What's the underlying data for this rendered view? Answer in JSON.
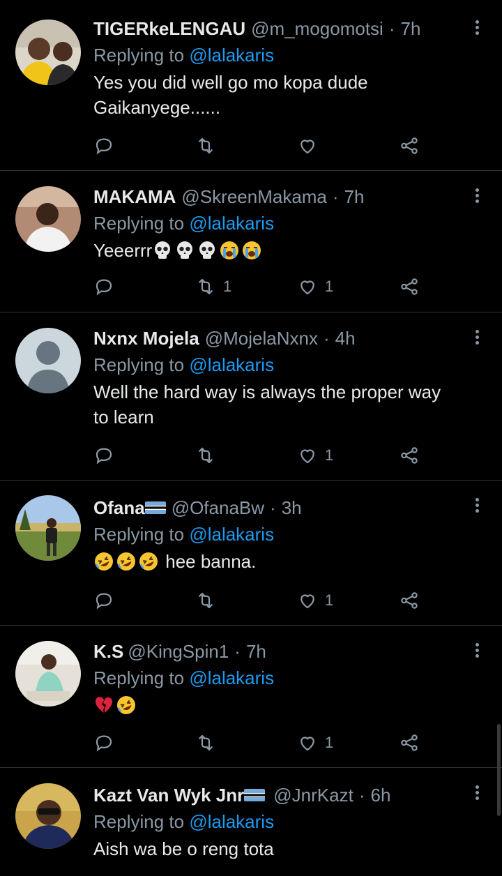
{
  "tweets": [
    {
      "name": "TIGERkeLENGAU",
      "handle": "@m_mogomotsi",
      "dot": "·",
      "time": "7h",
      "replying_prefix": "Replying to",
      "replying_to": "@lalakaris",
      "text_lines": [
        "Yes you did well go mo kopa dude",
        "Gaikanyege......"
      ],
      "retweets": "",
      "likes": ""
    },
    {
      "name": "MAKAMA",
      "handle": "@SkreenMakama",
      "dot": "·",
      "time": "7h",
      "replying_prefix": "Replying to",
      "replying_to": "@lalakaris",
      "text_lines": [
        "Yeeerrr"
      ],
      "emojis_after": [
        "skull",
        "skull",
        "skull",
        "loudly-crying-face",
        "loudly-crying-face"
      ],
      "retweets": "1",
      "likes": "1"
    },
    {
      "name": "Nxnx Mojela",
      "handle": "@MojelaNxnx",
      "dot": "·",
      "time": "4h",
      "replying_prefix": "Replying to",
      "replying_to": "@lalakaris",
      "text_lines": [
        "Well the hard way is always the proper way",
        "to learn"
      ],
      "retweets": "",
      "likes": "1"
    },
    {
      "name": "Ofana",
      "name_flag": "botswana-flag",
      "handle": "@OfanaBw",
      "dot": "·",
      "time": "3h",
      "replying_prefix": "Replying to",
      "replying_to": "@lalakaris",
      "emojis_before": [
        "rolling-on-floor-laughing",
        "rolling-on-floor-laughing",
        "rolling-on-floor-laughing"
      ],
      "text_lines": [
        "hee banna."
      ],
      "retweets": "",
      "likes": "1"
    },
    {
      "name": "K.S",
      "handle": "@KingSpin1",
      "dot": "·",
      "time": "7h",
      "replying_prefix": "Replying to",
      "replying_to": "@lalakaris",
      "emojis_before": [
        "broken-heart",
        "rolling-on-floor-laughing"
      ],
      "text_lines": [
        ""
      ],
      "retweets": "",
      "likes": "1"
    },
    {
      "name": "Kazt Van Wyk Jnr",
      "name_flag": "botswana-flag",
      "handle": "@JnrKazt",
      "dot": "·",
      "time": "6h",
      "replying_prefix": "Replying to",
      "replying_to": "@lalakaris",
      "text_lines": [
        "Aish wa be o reng tota"
      ],
      "retweets": "",
      "likes": ""
    }
  ],
  "icons": {
    "reply": "reply-icon",
    "retweet": "retweet-icon",
    "like": "like-icon",
    "share": "share-icon",
    "more": "more-options-icon"
  },
  "colors": {
    "background": "#000000",
    "text": "#e7e9ea",
    "secondary": "#8b98a5",
    "mention": "#1d9bf0",
    "divider": "#2f3336"
  }
}
